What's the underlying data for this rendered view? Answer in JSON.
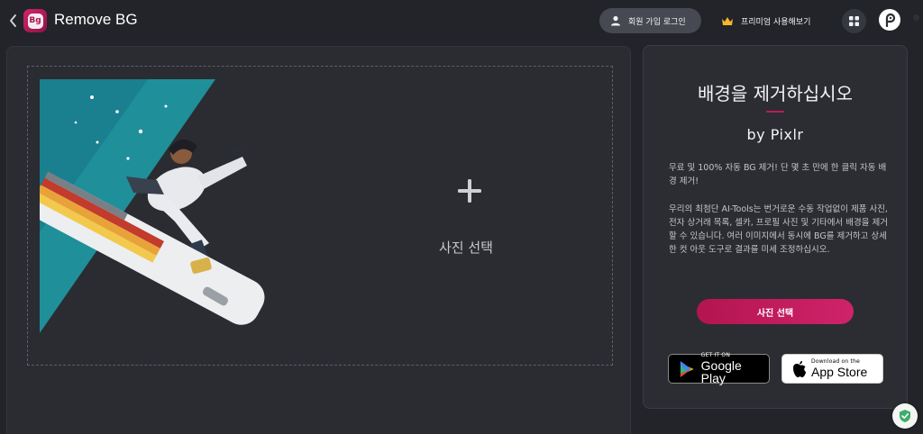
{
  "header": {
    "back_icon": "chevron-left-icon",
    "logo_text": "Bg",
    "title": "Remove BG",
    "signup_login_label": "회원 가입 로그인",
    "premium_label": "프리미엄 사용해보기",
    "apps_icon": "grid-icon",
    "brand_icon": "pixlr-icon"
  },
  "upload": {
    "add_icon": "plus-icon",
    "select_label": "사진 선택"
  },
  "promo": {
    "headline": "배경을 제거하십시오",
    "byline": "by Pixlr",
    "description_1": "무료 및 100% 자동 BG 제거! 단 몇 초 만에 한 클릭 자동 배경 제거!",
    "description_2": "우리의 최첨단 AI-Tools는 번거로운 수동 작업없이 제품 사진, 전자 상거래 목록, 셀카, 프로필 사진 및 기타에서 배경을 제거 할 수 있습니다. 여러 이미지에서 동시에 BG를 제거하고 상세한 컷 아웃 도구로 결과를 미세 조정하십시오.",
    "cta_label": "사진 선택",
    "google_play": {
      "small": "GET IT ON",
      "big": "Google Play"
    },
    "app_store": {
      "small": "Download on the",
      "big": "App Store"
    }
  },
  "colors": {
    "accent": "#c01a5c",
    "background": "#222429",
    "panel": "#2b2d32"
  }
}
